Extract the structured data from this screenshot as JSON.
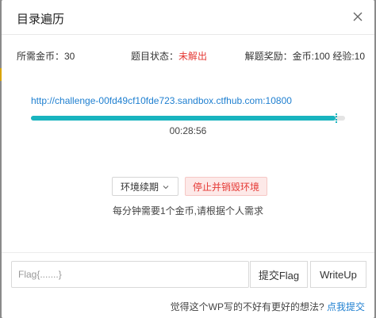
{
  "modal": {
    "title": "目录遍历"
  },
  "info": {
    "cost": "所需金币：30",
    "status_label": "题目状态：",
    "status_value": "未解出",
    "reward": "解题奖励：金币:100 经验:10"
  },
  "environment": {
    "url": "http://challenge-00fd49cf10fde723.sandbox.ctfhub.com:10800",
    "remaining_fraction": 0.97,
    "timer": "00:28:56",
    "renew_label": "环境续期",
    "stop_label": "停止并销毁环境",
    "hint": "每分钟需要1个金币,请根据个人需求"
  },
  "flag_form": {
    "placeholder": "Flag{.......}",
    "value": "",
    "submit_label": "提交Flag",
    "writeup_label": "WriteUp"
  },
  "footer": {
    "feedback_text": "觉得这个WP写的不好有更好的想法? ",
    "feedback_link": "点我提交"
  },
  "colors": {
    "progress": "#19b4bf",
    "danger": "#e53935",
    "link": "#1e7fd0"
  }
}
